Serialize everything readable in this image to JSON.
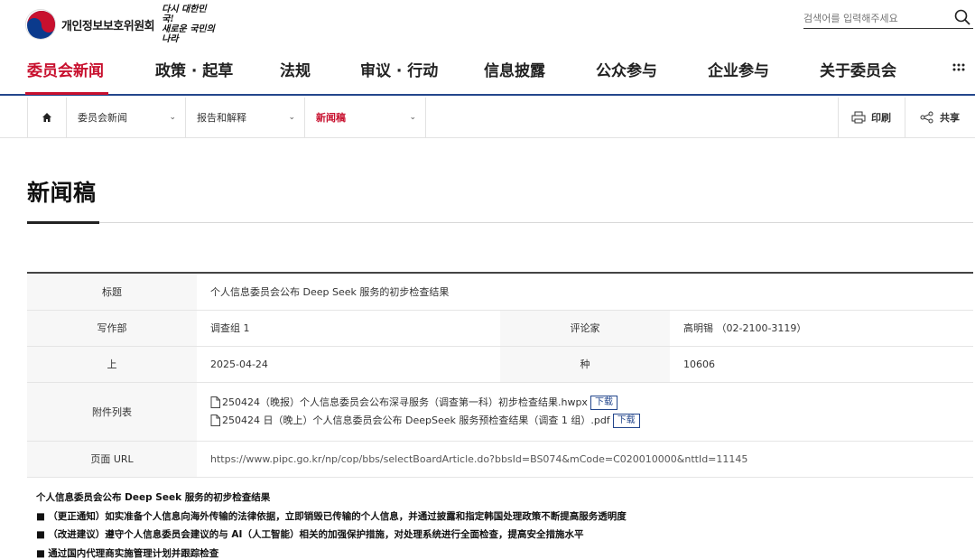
{
  "header": {
    "org_name": "개인정보보호위원회",
    "slogan_line1": "다시 대한민국!",
    "slogan_line2": "새로운 국민의 나라",
    "search_placeholder": "검색어를 입력해주세요"
  },
  "nav": {
    "items": [
      {
        "label": "委员会新闻"
      },
      {
        "label": "政策 · 起草"
      },
      {
        "label": "法规"
      },
      {
        "label": "审议 · 行动"
      },
      {
        "label": "信息披露"
      },
      {
        "label": "公众参与"
      },
      {
        "label": "企业参与"
      },
      {
        "label": "关于委员会"
      }
    ],
    "active_color": "#c8102e",
    "accent_color": "#23468c"
  },
  "breadcrumb": {
    "items": [
      {
        "label": "委员会新闻"
      },
      {
        "label": "报告和解释"
      },
      {
        "label": "新闻稿"
      }
    ],
    "print_label": "印刷",
    "share_label": "共享"
  },
  "page": {
    "title": "新闻稿"
  },
  "info": {
    "title_label": "标题",
    "title_value": "个人信息委员会公布 Deep Seek 服务的初步检查结果",
    "dept_label": "写作部",
    "dept_value": "调查组 1",
    "reviewer_label": "评论家",
    "reviewer_value": "高明锡 （02-2100-3119）",
    "date_label": "上",
    "date_value": "2025-04-24",
    "views_label": "种",
    "views_value": "10606",
    "attach_label": "附件列表",
    "attachments": [
      {
        "name": "250424（晚报）个人信息委员会公布深寻服务（调查第一科）初步检查结果.hwpx",
        "action": "下载"
      },
      {
        "name": "250424 日（晚上）个人信息委员会公布 DeepSeek 服务预检查结果（调查 1 组）.pdf",
        "action": "下载"
      }
    ],
    "url_label": "页面 URL",
    "url_value": "https://www.pipc.go.kr/np/cop/bbs/selectBoardArticle.do?bbsId=BS074&mCode=C020010000&nttId=11145"
  },
  "body": {
    "lead": "个人信息委员会公布 Deep Seek 服务的初步检查结果",
    "lines": [
      {
        "bullet": "■",
        "text": "（更正通知）如实准备个人信息向海外传输的法律依据，立即销毁已传输的个人信息，并通过披露和指定韩国处理政策不断提高服务透明度"
      },
      {
        "bullet": "■",
        "text": "（改进建议）遵守个人信息委员会建议的与 AI（人工智能）相关的加强保护措施，对处理系统进行全面检查，提高安全措施水平"
      },
      {
        "bullet": "■",
        "text": "通过国内代理商实施管理计划并跟踪检查"
      }
    ]
  }
}
